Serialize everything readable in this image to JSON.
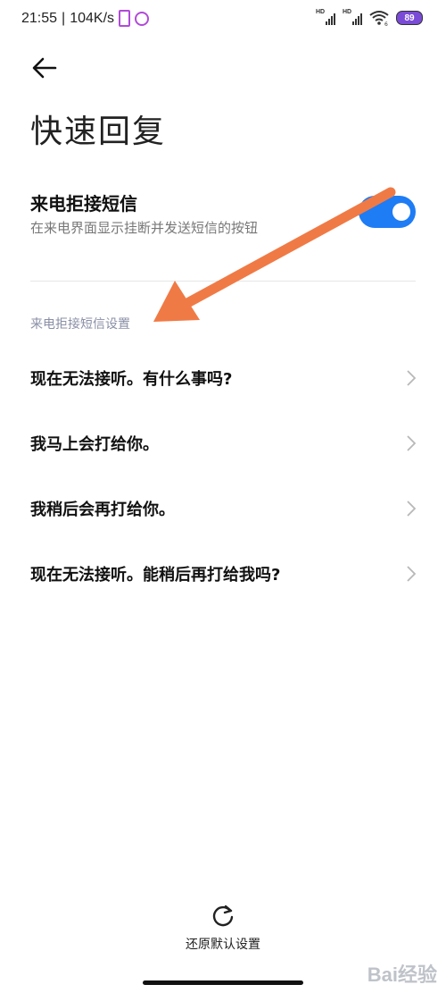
{
  "status_bar": {
    "time": "21:55",
    "separator": "|",
    "speed": "104K/s",
    "battery": "89",
    "wifi_badge": "6"
  },
  "header": {
    "back_icon": "arrow-left-icon",
    "title": "快速回复"
  },
  "reject_sms": {
    "title": "来电拒接短信",
    "subtitle": "在来电界面显示挂断并发送短信的按钮",
    "enabled": true
  },
  "settings_section": {
    "header": "来电拒接短信设置",
    "items": [
      {
        "label": "现在无法接听。有什么事吗?"
      },
      {
        "label": "我马上会打给你。"
      },
      {
        "label": "我稍后会再打给你。"
      },
      {
        "label": "现在无法接听。能稍后再打给我吗?"
      }
    ]
  },
  "footer": {
    "reset_label": "还原默认设置",
    "reset_icon": "refresh-icon"
  },
  "watermark": {
    "text": "Bai经验"
  },
  "colors": {
    "accent": "#1e7cf5",
    "annotation_arrow": "#f07a45",
    "section_header": "#8a8fa6"
  }
}
